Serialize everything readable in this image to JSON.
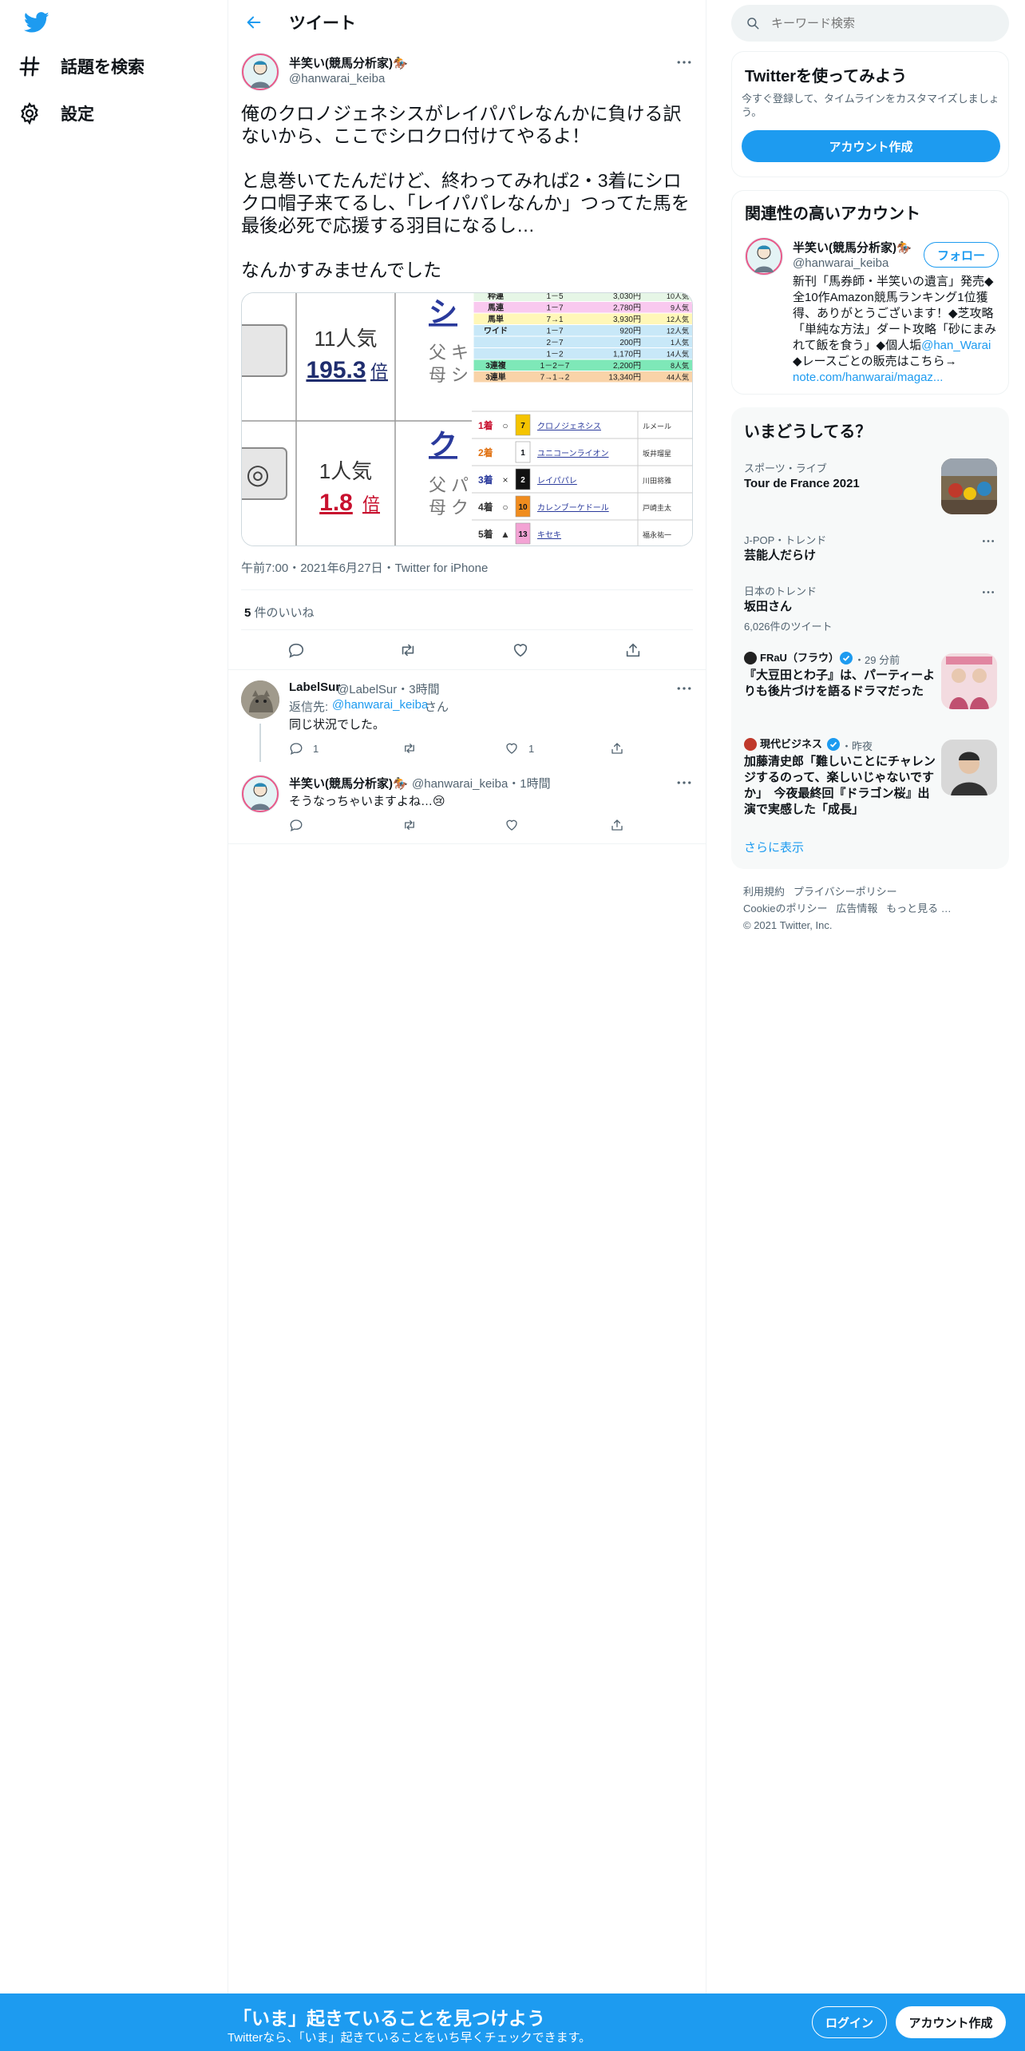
{
  "nav": {
    "search_label": "話題を検索",
    "settings_label": "設定"
  },
  "header": {
    "title": "ツイート"
  },
  "tweet": {
    "name": "半笑い(競馬分析家)🏇",
    "handle": "@hanwarai_keiba",
    "body": "俺のクロノジェネシスがレイパパレなんかに負ける訳ないから、ここでシロクロ付けてやるよ！\n\nと息巻いてたんだけど、終わってみれば2・3着にシロクロ帽子来てるし、「レイパパレなんか」つってた馬を最後必死で応援する羽目になるし…\n\nなんかすみませんでした",
    "meta": "午前7:00・2021年6月27日・Twitter for iPhone",
    "likes_count": "5",
    "likes_label": "件のいいね"
  },
  "media": {
    "row1_pop": "11人気",
    "row1_odds": "195.3",
    "row2_pop": "1人気",
    "row2_odds": "1.8",
    "odds_unit": "倍",
    "row1_name": "シ",
    "row2_name": "ク",
    "father": "父",
    "mother": "母",
    "row1_f": "キ",
    "row1_m": "シ",
    "row2_f": "パ",
    "row2_m": "ク",
    "row2_symbol": "◎",
    "payouts": [
      {
        "type": "枠連",
        "combo": "1－5",
        "amount": "3,030円",
        "pop": "10人気",
        "color": "#e6f6e6"
      },
      {
        "type": "馬連",
        "combo": "1－7",
        "amount": "2,780円",
        "pop": "9人気",
        "color": "#f9c9ef"
      },
      {
        "type": "馬単",
        "combo": "7→1",
        "amount": "3,930円",
        "pop": "12人気",
        "color": "#fff7b8"
      },
      {
        "type": "ワイド",
        "combo": "1－7",
        "amount": "920円",
        "pop": "12人気",
        "color": "#c8e8f8"
      },
      {
        "type": "",
        "combo": "2－7",
        "amount": "200円",
        "pop": "1人気",
        "color": "#c8e8f8"
      },
      {
        "type": "",
        "combo": "1－2",
        "amount": "1,170円",
        "pop": "14人気",
        "color": "#c8e8f8"
      },
      {
        "type": "3連複",
        "combo": "1－2－7",
        "amount": "2,200円",
        "pop": "8人気",
        "color": "#7ee8b8"
      },
      {
        "type": "3連単",
        "combo": "7→1→2",
        "amount": "13,340円",
        "pop": "44人気",
        "color": "#f9d3a8"
      }
    ],
    "results": [
      {
        "place": "1着",
        "mark": "○",
        "num": "7",
        "horse": "クロノジェネシス",
        "jockey": "ルメール",
        "numbg": "#f5c400",
        "numfg": "#0f1419"
      },
      {
        "place": "2着",
        "mark": "",
        "num": "1",
        "horse": "ユニコーンライオン",
        "jockey": "坂井瑠星",
        "numbg": "#ffffff",
        "numfg": "#0f1419"
      },
      {
        "place": "3着",
        "mark": "×",
        "num": "2",
        "horse": "レイパパレ",
        "jockey": "川田将雅",
        "numbg": "#111111",
        "numfg": "#ffffff"
      },
      {
        "place": "4着",
        "mark": "○",
        "num": "10",
        "horse": "カレンブーケドール",
        "jockey": "戸崎圭太",
        "numbg": "#f08c1e",
        "numfg": "#0f1419"
      },
      {
        "place": "5着",
        "mark": "▲",
        "num": "13",
        "horse": "キセキ",
        "jockey": "福永祐一",
        "numbg": "#f3a3d4",
        "numfg": "#0f1419"
      }
    ]
  },
  "replies": [
    {
      "name": "LabelSur",
      "meta": "@LabelSur・3時間",
      "reply_to_label": "返信先:",
      "reply_to": "@hanwarai_keiba",
      "reply_to_suffix": "さん",
      "text": "同じ状況でした。",
      "reply_count": "1",
      "like_count": "1"
    },
    {
      "name": "半笑い(競馬分析家)🏇",
      "meta": "@hanwarai_keiba・1時間",
      "text": "そうなっちゃいますよね…😢"
    }
  ],
  "search": {
    "placeholder": "キーワード検索"
  },
  "signup_card": {
    "title": "Twitterを使ってみよう",
    "subtitle": "今すぐ登録して、タイムラインをカスタマイズしましょう。",
    "button": "アカウント作成"
  },
  "related": {
    "title": "関連性の高いアカウント",
    "name": "半笑い(競馬分析家)🏇",
    "handle": "@hanwarai_keiba",
    "follow": "フォロー",
    "bio_text": "全10作Amazon競馬ランキング1位獲得、ありがとうございます！◆芝攻略「単純な方法」ダート攻略「砂にまみれて飯を食う」◆個人垢",
    "bio_prefix": "新刊「馬券師・半笑いの遺言」発売◆",
    "bio_link": "@han_Warai",
    "bio_text2": "◆レースごとの販売はこちら→",
    "bio_url": "note.com/hanwarai/magaz..."
  },
  "trends": {
    "title": "いまどうしてる？",
    "items": [
      {
        "context": "スポーツ・ライブ",
        "title": "Tour de France 2021"
      },
      {
        "context": "J-POP・トレンド",
        "title": "芸能人だらけ"
      },
      {
        "context": "日本のトレンド",
        "title": "坂田さん",
        "sub": "6,026件のツイート"
      },
      {
        "source": "FRaU（フラウ）",
        "time": "・29 分前",
        "title": "『大豆田とわ子』は、パーティーよりも後片づけを語るドラマだった"
      },
      {
        "source": "現代ビジネス",
        "time": "・昨夜",
        "title": "加藤清史郎「難しいことにチャレンジするのって、楽しいじゃないですか」　今夜最終回『ドラゴン桜』出演で実感した「成長」"
      }
    ],
    "show_more": "さらに表示"
  },
  "footer": {
    "terms": "利用規約",
    "privacy": "プライバシーポリシー",
    "cookie": "Cookieのポリシー",
    "ads": "広告情報",
    "more": "もっと見る …",
    "copyright": "© 2021 Twitter, Inc."
  },
  "bottombar": {
    "title": "「いま」起きていることを見つけよう",
    "subtitle": "Twitterなら、「いま」起きていることをいち早くチェックできます。",
    "login": "ログイン",
    "signup": "アカウント作成"
  },
  "colors": {
    "accent": "#1d9bf0",
    "text": "#0f1419",
    "muted": "#536471",
    "border": "#eff3f4"
  }
}
